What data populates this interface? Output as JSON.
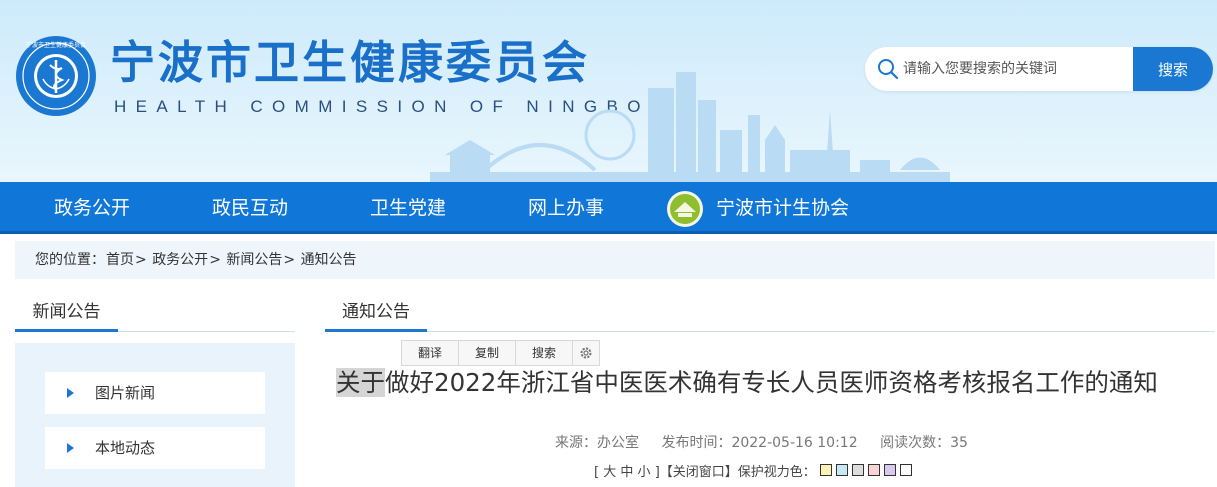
{
  "header": {
    "title": "宁波市卫生健康委员会",
    "subtitle": "HEALTH COMMISSION OF NINGBO",
    "emblem_text": "宁波市卫生健康委员会 HEALTH COMMISSION OF NINGBO"
  },
  "search": {
    "placeholder": "请输入您要搜索的关键词",
    "button_label": "搜索"
  },
  "nav": {
    "items": [
      "政务公开",
      "政民互动",
      "卫生党建",
      "网上办事"
    ],
    "association": "宁波市计生协会"
  },
  "breadcrumb": {
    "prefix": "您的位置：",
    "items": [
      "首页",
      "政务公开",
      "新闻公告",
      "通知公告"
    ],
    "separator": ">"
  },
  "sidebar": {
    "title": "新闻公告",
    "items": [
      "图片新闻",
      "本地动态"
    ]
  },
  "main": {
    "tab": "通知公告",
    "toolbar": {
      "translate": "翻译",
      "copy": "复制",
      "search": "搜索",
      "settings_icon": "gear-icon"
    },
    "article": {
      "title_highlight": "关于",
      "title_rest": "做好2022年浙江省中医医术确有专长人员医师资格考核报名工作的通知",
      "source": "来源：办公室",
      "publish_time": "发布时间：2022-05-16 10:12",
      "read_count": "阅读次数：35"
    },
    "controls": {
      "size_open": "[",
      "size_large": "大",
      "size_medium": "中",
      "size_small": "小",
      "size_close": "]",
      "close_window": "【关闭窗口】",
      "eye_color_label": "保护视力色：",
      "swatches": [
        "#fbf2b7",
        "#c7e8f6",
        "#dddddd",
        "#f7d3d8",
        "#d9c9ef",
        "#ffffff"
      ]
    }
  },
  "colors": {
    "brand_blue": "#1077d8",
    "title_blue": "#1a6fc9"
  }
}
